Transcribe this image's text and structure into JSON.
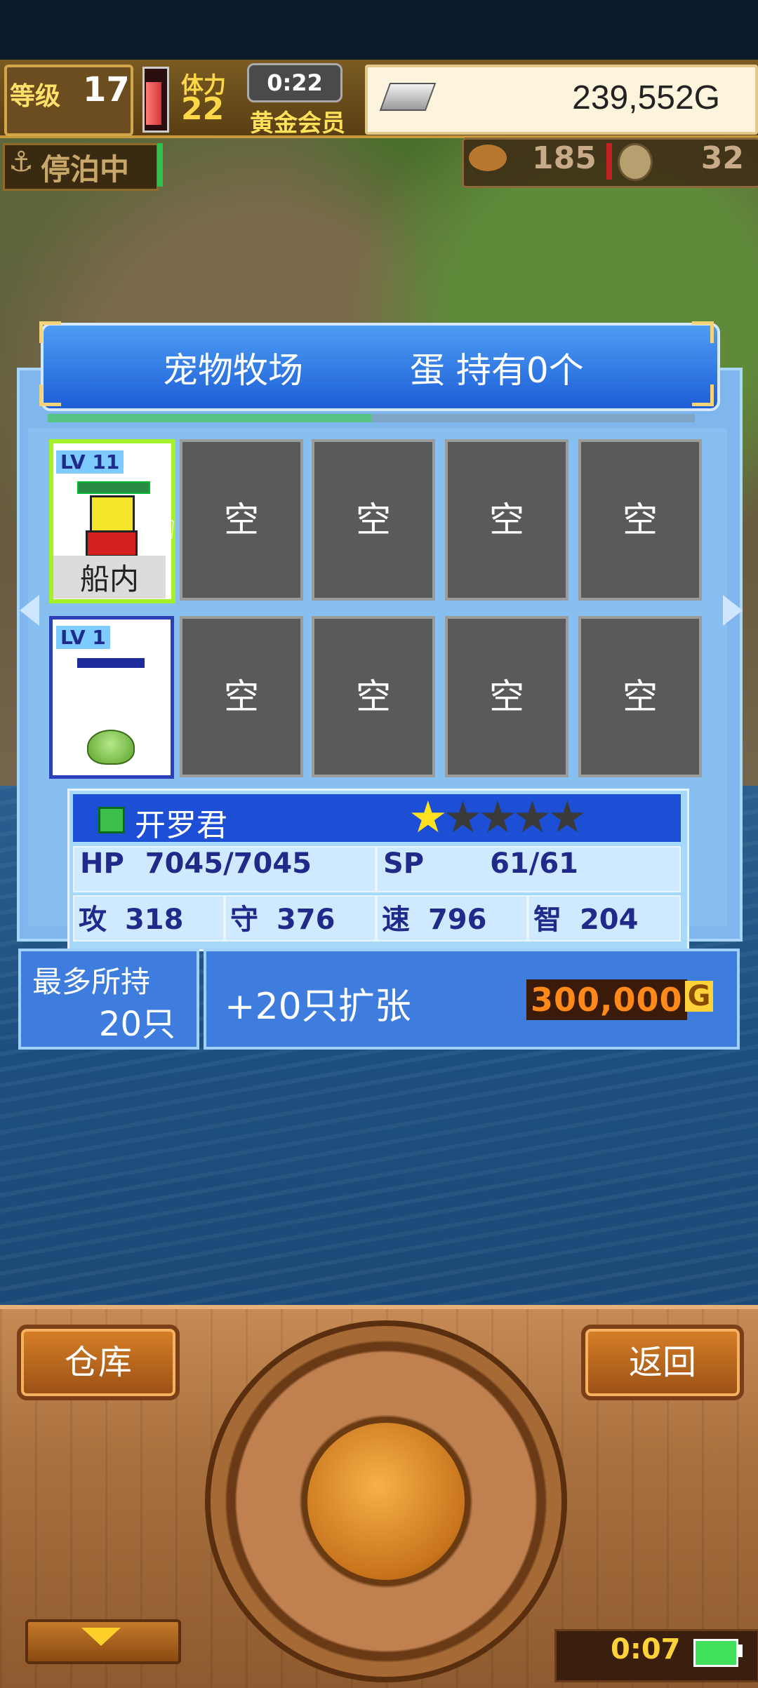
{
  "status": {
    "level_label": "等级",
    "level": "17",
    "stamina_label": "体力",
    "stamina": "22",
    "timer": "0:22",
    "membership": "黄金会员",
    "gold": "239,552G",
    "stamina_fill": 0.85
  },
  "port": {
    "status_label": "停泊中",
    "food": "185",
    "coins": "32"
  },
  "ranch": {
    "title": "宠物牧场",
    "eggs": "蛋 持有0个",
    "progress": 0.5,
    "slots_row1": [
      {
        "type": "pet",
        "lv": "LV",
        "lv_num": "11",
        "location": "船内"
      },
      {
        "type": "empty",
        "label": "空"
      },
      {
        "type": "empty",
        "label": "空"
      },
      {
        "type": "empty",
        "label": "空"
      },
      {
        "type": "empty",
        "label": "空"
      }
    ],
    "slots_row2": [
      {
        "type": "pet",
        "lv": "LV",
        "lv_num": "1"
      },
      {
        "type": "empty",
        "label": "空"
      },
      {
        "type": "empty",
        "label": "空"
      },
      {
        "type": "empty",
        "label": "空"
      },
      {
        "type": "empty",
        "label": "空"
      }
    ]
  },
  "pet_stats": {
    "name": "开罗君",
    "stars": 1,
    "stars_max": 5,
    "hp_label": "HP",
    "hp": "7045/7045",
    "sp_label": "SP",
    "sp": "61/61",
    "atk_label": "攻",
    "atk": "318",
    "def_label": "守",
    "def": "376",
    "spd_label": "速",
    "spd": "796",
    "int_label": "智",
    "int": "204"
  },
  "capacity": {
    "label": "最多所持",
    "value": "20只",
    "expand_label": "+20只扩张",
    "expand_price": "300,000",
    "currency": "G"
  },
  "controls": {
    "warehouse": "仓库",
    "back": "返回",
    "clock": "0:07"
  },
  "colors": {
    "dialog": "#7fb6ee",
    "header": "#1d5ed7",
    "empty_slot": "#5a5a5a",
    "accent_green": "#a6f02a"
  }
}
